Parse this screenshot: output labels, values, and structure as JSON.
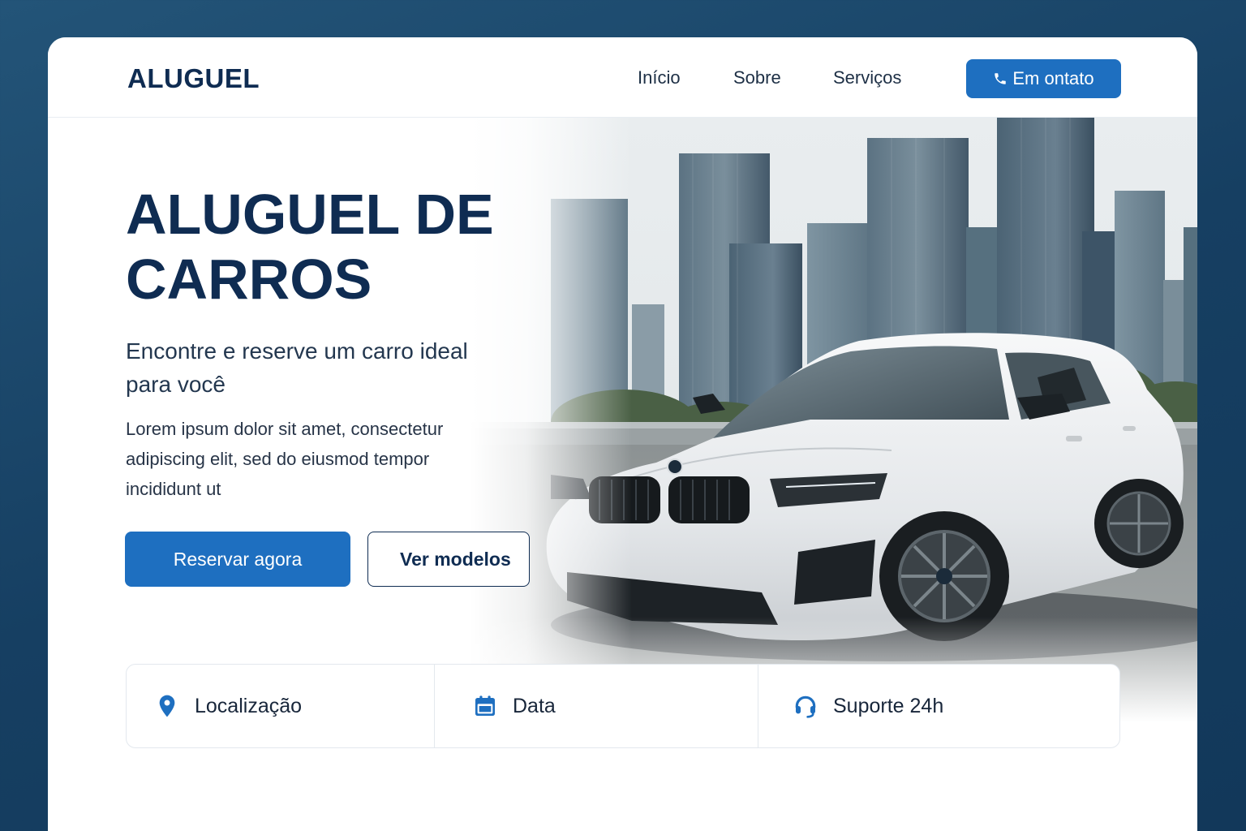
{
  "header": {
    "logo": "ALUGUEL",
    "nav": [
      "Início",
      "Sobre",
      "Serviços"
    ],
    "contact_label": "Em ontato",
    "contact_icon": "phone-icon"
  },
  "hero": {
    "title_line1": "ALUGUEL DE",
    "title_line2": "CARROS",
    "subtitle": "Encontre e reserve um carro ideal para você",
    "body": "Lorem ipsum dolor sit amet, consectetur adipiscing elit, sed do eiusmod tempor incididunt ut",
    "primary_button": "Reservar agora",
    "secondary_button": "Ver modelos"
  },
  "features": [
    {
      "label": "Localização",
      "icon": "location-pin-icon"
    },
    {
      "label": "Data",
      "icon": "calendar-icon"
    },
    {
      "label": "Suporte 24h",
      "icon": "headset-icon"
    }
  ],
  "colors": {
    "background": "#163f62",
    "primary": "#1e6fc0",
    "heading": "#0f2c52"
  }
}
